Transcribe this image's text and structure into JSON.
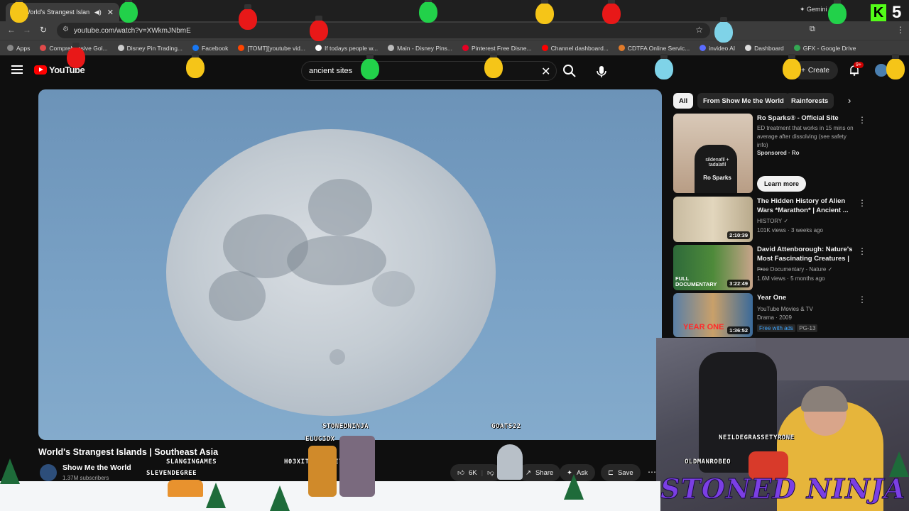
{
  "browser": {
    "tab_title": "World's Strangest Islan",
    "url": "youtube.com/watch?v=XWkmJNbmE",
    "gemini": "Gemini",
    "bookmarks": [
      {
        "label": "Apps",
        "color": "#888888"
      },
      {
        "label": "Comprehensive Gol...",
        "color": "#e04a4a"
      },
      {
        "label": "Disney Pin Trading...",
        "color": "#cccccc"
      },
      {
        "label": "Facebook",
        "color": "#1877f2"
      },
      {
        "label": "[TOMT][youtube vid...",
        "color": "#ff4500"
      },
      {
        "label": "If todays people w...",
        "color": "#ffffff"
      },
      {
        "label": "Main - Disney Pins...",
        "color": "#bbbbbb"
      },
      {
        "label": "Pinterest Free Disne...",
        "color": "#e60023"
      },
      {
        "label": "Channel dashboard...",
        "color": "#ff0000"
      },
      {
        "label": "CDTFA Online Servic...",
        "color": "#e07a2a"
      },
      {
        "label": "invideo AI",
        "color": "#5a6cff"
      },
      {
        "label": "Dashboard",
        "color": "#dddddd"
      },
      {
        "label": "GFX - Google Drive",
        "color": "#34a853"
      }
    ]
  },
  "youtube": {
    "logo_text": "YouTube",
    "search_value": "ancient sites",
    "create_label": "Create",
    "notification_badge": "9+"
  },
  "video": {
    "title": "World's Strangest Islands | Southeast Asia",
    "channel": "Show Me the World",
    "subscribers": "1.37M subscribers",
    "likes": "6K",
    "share_label": "Share",
    "ask_label": "Ask",
    "save_label": "Save"
  },
  "chips": [
    {
      "label": "All",
      "active": true
    },
    {
      "label": "From Show Me the World",
      "active": false
    },
    {
      "label": "Rainforests",
      "active": false
    }
  ],
  "recommendations": [
    {
      "title": "Ro Sparks® - Official Site",
      "meta1": "ED treatment that works in 15 mins on average after dissolving (see safety info)",
      "meta2": "Sponsored · Ro",
      "button": "Learn more",
      "duration": ""
    },
    {
      "title": "The Hidden History of Alien Wars *Marathon* | Ancient ...",
      "meta1": "HISTORY",
      "meta2": "101K views · 3 weeks ago",
      "duration": "2:10:39"
    },
    {
      "title": "David Attenborough: Nature's Most Fascinating Creatures | ...",
      "meta1": "Free Documentary - Nature",
      "meta2": "1.6M views · 5 months ago",
      "duration": "3:22:49"
    },
    {
      "title": "Year One",
      "meta1": "YouTube Movies & TV",
      "meta2": "Drama · 2009",
      "meta3": "Free with ads",
      "meta4": "PG-13",
      "duration": "1:36:52"
    }
  ],
  "thumb_text": {
    "ad": "Ro Sparks",
    "ad_small": "sildenafil + tadalafil",
    "documentary": "FULL DOCUMENTARY",
    "yearone": "YEAR ONE"
  },
  "overlay": {
    "stream_title": "STONED NINJA",
    "counter": "5",
    "usernames": [
      "STONEDNINJA",
      "GOATS22",
      "ELUCIDX",
      "SLANGINGAMES",
      "H03XITSXOMONEY",
      "SLEVENDEGREE",
      "NEILDEGRASSETYRONE",
      "OLDMANROBEO"
    ]
  }
}
